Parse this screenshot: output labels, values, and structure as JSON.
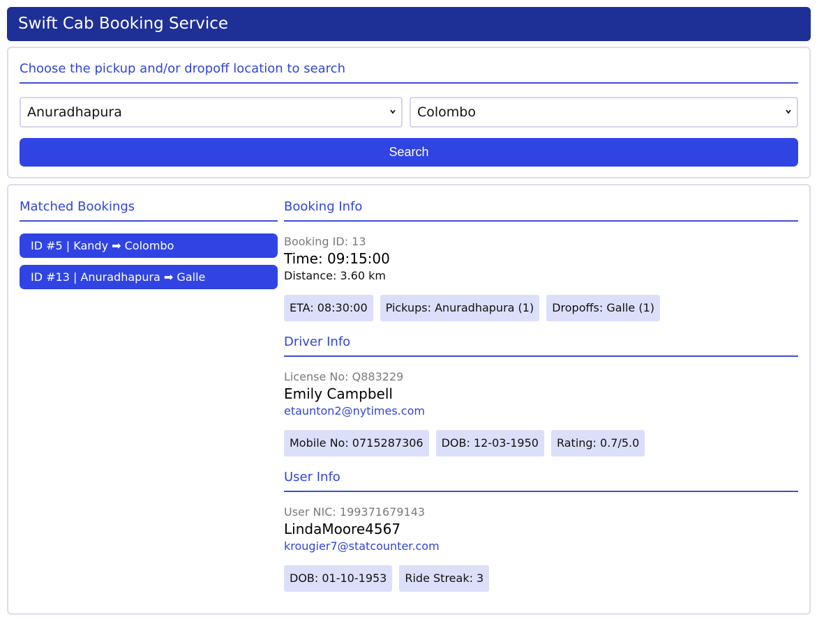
{
  "app": {
    "title": "Swift Cab Booking Service"
  },
  "search": {
    "title": "Choose the pickup and/or dropoff location to search",
    "pickup_value": "Anuradhapura",
    "dropoff_value": "Colombo",
    "button_label": "Search"
  },
  "matched": {
    "title": "Matched Bookings",
    "items": [
      {
        "label": "ID #5 | Kandy  ➡ Colombo"
      },
      {
        "label": "ID #13 | Anuradhapura  ➡ Galle"
      }
    ]
  },
  "booking": {
    "title": "Booking Info",
    "id_line": "Booking ID: 13",
    "time_line": "Time: 09:15:00",
    "distance_line": "Distance: 3.60 km",
    "chips": [
      "ETA: 08:30:00",
      "Pickups: Anuradhapura (1)",
      "Dropoffs: Galle (1)"
    ]
  },
  "driver": {
    "title": "Driver Info",
    "license_line": "License No: Q883229",
    "name": "Emily Campbell",
    "email": "etaunton2@nytimes.com",
    "chips": [
      "Mobile No: 0715287306",
      "DOB: 12-03-1950",
      "Rating: 0.7/5.0"
    ]
  },
  "user": {
    "title": "User Info",
    "nic_line": "User NIC: 199371679143",
    "name": "LindaMoore4567",
    "email": "krougier7@statcounter.com",
    "chips": [
      "DOB: 01-10-1953",
      "Ride Streak: 3"
    ]
  },
  "colors": {
    "header_bg": "#1e2f96",
    "accent": "#3044e4",
    "chip_bg": "#dcdff9"
  }
}
